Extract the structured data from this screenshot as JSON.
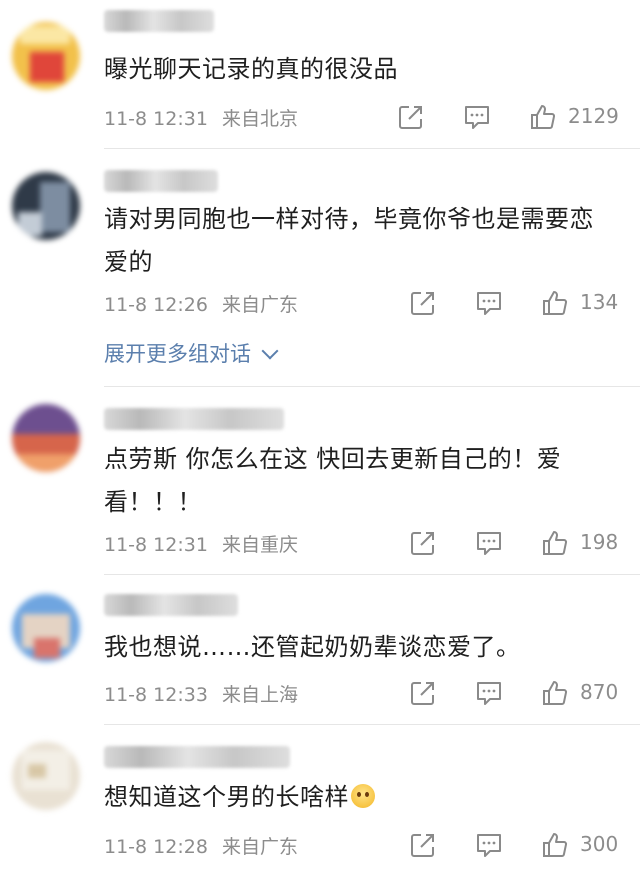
{
  "expand_label": "展开更多组对话",
  "comments": [
    {
      "text": "曝光聊天记录的真的很没品",
      "time": "11-8 12:31",
      "location": "来自北京",
      "likes": "2129",
      "avatar_colors": [
        "#f2c14b",
        "#e0463a",
        "#fbe7a4"
      ]
    },
    {
      "text": "请对男同胞也一样对待，毕竟你爷也是需要恋爱的",
      "time": "11-8 12:26",
      "location": "来自广东",
      "likes": "134",
      "avatar_colors": [
        "#2f3a48",
        "#7d8da1",
        "#c3ccd6"
      ]
    },
    {
      "text": "点劳斯 你怎么在这 快回去更新自己的！爱看！！！",
      "time": "11-8 12:31",
      "location": "来自重庆",
      "likes": "198",
      "avatar_colors": [
        "#6d4f8f",
        "#d6654b",
        "#f0a06a"
      ]
    },
    {
      "text": "我也想说……还管起奶奶辈谈恋爱了。",
      "time": "11-8 12:33",
      "location": "来自上海",
      "likes": "870",
      "avatar_colors": [
        "#6fa5e0",
        "#e4d3c4",
        "#d9746c"
      ]
    },
    {
      "text": "想知道这个男的长啥样",
      "time": "11-8 12:28",
      "location": "来自广东",
      "likes": "300",
      "avatar_colors": [
        "#e9e1d3",
        "#f3efe6",
        "#d8c7a6"
      ]
    }
  ],
  "icons": {
    "share": "share-icon",
    "comment": "comment-icon",
    "like": "thumbs-up-icon",
    "expand": "chevron-down-icon"
  }
}
